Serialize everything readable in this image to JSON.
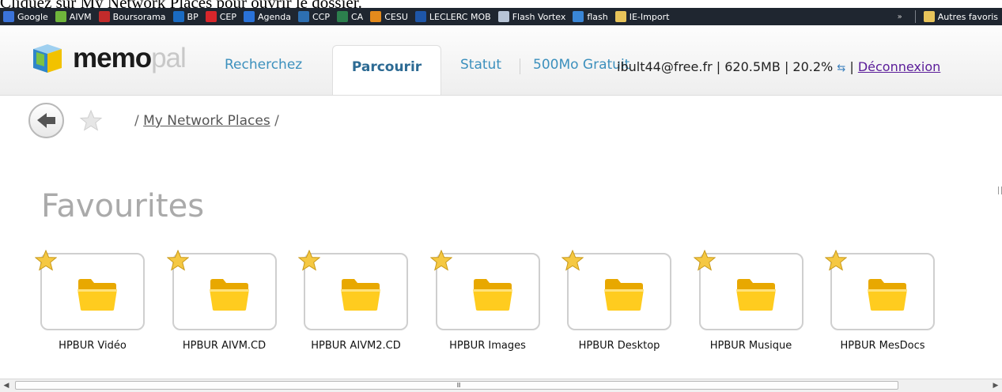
{
  "caption": "Cliquez sur My Network Places pour ouvrir le dossier.",
  "bookmarks": [
    {
      "label": "Google",
      "color": "#3b73d9"
    },
    {
      "label": "AIVM",
      "color": "#6fb53b"
    },
    {
      "label": "Boursorama",
      "color": "#c22b2b"
    },
    {
      "label": "BP",
      "color": "#1a6bc2"
    },
    {
      "label": "CEP",
      "color": "#d8262b"
    },
    {
      "label": "Agenda",
      "color": "#2a72d8"
    },
    {
      "label": "CCP",
      "color": "#2d6fb1"
    },
    {
      "label": "CA",
      "color": "#2c7f4d"
    },
    {
      "label": "CESU",
      "color": "#e38a1c"
    },
    {
      "label": "LECLERC MOB",
      "color": "#1e56a8"
    },
    {
      "label": "Flash Vortex",
      "color": "#b7c4d6"
    },
    {
      "label": "flash",
      "color": "#3a86d6"
    },
    {
      "label": "IE-Import",
      "color": "#e8c45a"
    }
  ],
  "bookmarks_other": "Autres favoris",
  "bookmarks_more": "»",
  "logo": {
    "memo": "memo",
    "pal": "pal"
  },
  "nav": {
    "search": "Recherchez",
    "browse": "Parcourir",
    "status": "Statut",
    "free": "500Mo Gratuit"
  },
  "account": {
    "email": "ibult44@free.fr",
    "usage": "620.5MB",
    "percent": "20.2%",
    "logout": "Déconnexion"
  },
  "breadcrumb": {
    "link": "My Network Places"
  },
  "section_title": "Favourites",
  "favourites": [
    "HPBUR Vidéo",
    "HPBUR AIVM.CD",
    "HPBUR AIVM2.CD",
    "HPBUR Images",
    "HPBUR Desktop",
    "HPBUR Musique",
    "HPBUR MesDocs"
  ],
  "colors": {
    "accent": "#3c90bd",
    "folder": "#f9c31a",
    "star": "#f1c232"
  }
}
